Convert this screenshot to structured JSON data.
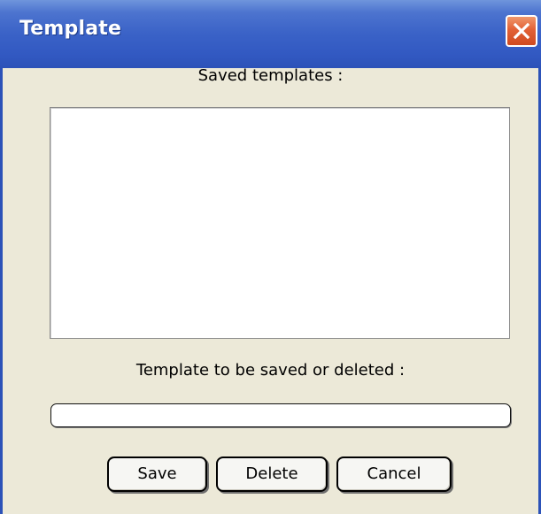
{
  "window": {
    "title": "Template",
    "close_icon": "close-icon"
  },
  "dialog": {
    "saved_templates_label": "Saved templates :",
    "saved_templates_items": [],
    "target_label": "Template to be saved or deleted :",
    "target_value": ""
  },
  "buttons": {
    "save_label": "Save",
    "delete_label": "Delete",
    "cancel_label": "Cancel"
  },
  "colors": {
    "titlebar_blue": "#3a62c7",
    "close_red": "#e26136",
    "dialog_bg": "#ece9d8"
  }
}
